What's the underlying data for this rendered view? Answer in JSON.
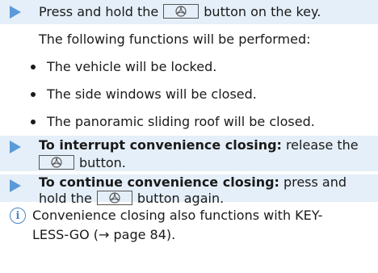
{
  "step1": {
    "before_key": "Press and hold the",
    "after_key": "button on the key.",
    "intro": "The following functions will be performed:"
  },
  "bullets": [
    "The vehicle will be locked.",
    "The side windows will be closed.",
    "The panoramic sliding roof will be closed."
  ],
  "step2": {
    "bold": "To interrupt convenience closing:",
    "text": "release the",
    "after_key": "button."
  },
  "step3": {
    "bold": "To continue convenience closing:",
    "text": "press and",
    "line2_before_key": "hold the",
    "line2_after_key": "button again."
  },
  "note": {
    "line1": "Convenience closing also functions with KEY-",
    "line2": "LESS-GO (→ page 84)."
  },
  "colors": {
    "arrow": "#5b9ad8",
    "band": "#e5eff9",
    "info_icon": "#4a86c5"
  },
  "icons": {
    "arrow": "step-arrow-icon",
    "key_button": "mercedes-star-icon",
    "info": "info-icon"
  }
}
